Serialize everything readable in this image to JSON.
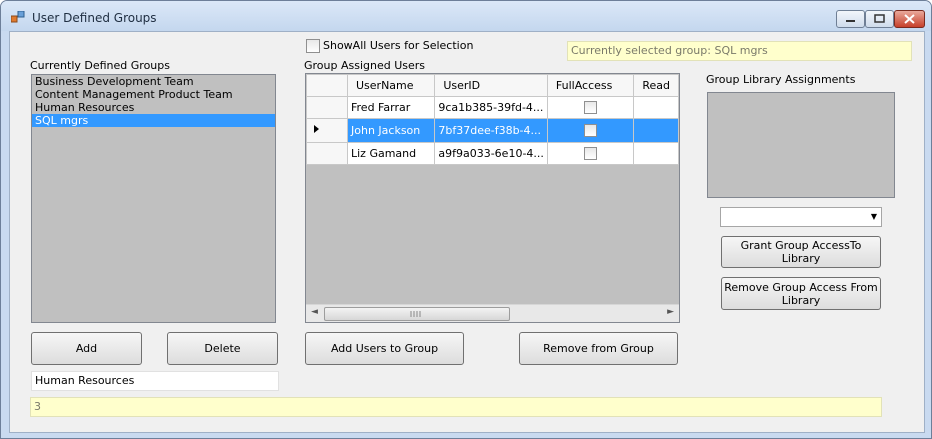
{
  "window": {
    "title": "User Defined Groups"
  },
  "show_all_users_label": "ShowAll Users for Selection",
  "current_group_status": "Currently selected group: SQL mgrs",
  "groups": {
    "label": "Currently Defined Groups",
    "items": [
      "Business Development Team",
      "Content Management Product Team",
      "Human Resources",
      "SQL mgrs"
    ],
    "selected_index": 3
  },
  "group_users": {
    "label": "Group Assigned Users",
    "columns": [
      "UserName",
      "UserID",
      "FullAccess",
      "Read"
    ],
    "rows": [
      {
        "username": "Fred Farrar",
        "userid": "9ca1b385-39fd-4..."
      },
      {
        "username": "John Jackson",
        "userid": "7bf37dee-f38b-4..."
      },
      {
        "username": "Liz Gamand",
        "userid": "a9f9a033-6e10-4..."
      }
    ],
    "selected_index": 1
  },
  "library": {
    "label": "Group Library Assignments",
    "combo_value": ""
  },
  "buttons": {
    "add": "Add",
    "delete": "Delete",
    "add_users": "Add Users to Group",
    "remove_from_group": "Remove from Group",
    "grant_access": "Grant Group AccessTo Library",
    "remove_access": "Remove Group Access From Library"
  },
  "group_name_input": "Human Resources",
  "bottom_status": "3"
}
